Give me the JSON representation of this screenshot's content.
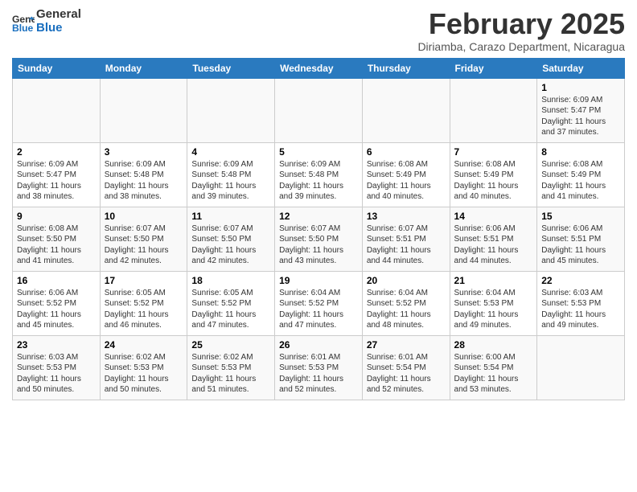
{
  "header": {
    "logo_line1": "General",
    "logo_line2": "Blue",
    "month_year": "February 2025",
    "location": "Diriamba, Carazo Department, Nicaragua"
  },
  "days_of_week": [
    "Sunday",
    "Monday",
    "Tuesday",
    "Wednesday",
    "Thursday",
    "Friday",
    "Saturday"
  ],
  "weeks": [
    [
      {
        "day": "",
        "info": ""
      },
      {
        "day": "",
        "info": ""
      },
      {
        "day": "",
        "info": ""
      },
      {
        "day": "",
        "info": ""
      },
      {
        "day": "",
        "info": ""
      },
      {
        "day": "",
        "info": ""
      },
      {
        "day": "1",
        "info": "Sunrise: 6:09 AM\nSunset: 5:47 PM\nDaylight: 11 hours and 37 minutes."
      }
    ],
    [
      {
        "day": "2",
        "info": "Sunrise: 6:09 AM\nSunset: 5:47 PM\nDaylight: 11 hours and 38 minutes."
      },
      {
        "day": "3",
        "info": "Sunrise: 6:09 AM\nSunset: 5:48 PM\nDaylight: 11 hours and 38 minutes."
      },
      {
        "day": "4",
        "info": "Sunrise: 6:09 AM\nSunset: 5:48 PM\nDaylight: 11 hours and 39 minutes."
      },
      {
        "day": "5",
        "info": "Sunrise: 6:09 AM\nSunset: 5:48 PM\nDaylight: 11 hours and 39 minutes."
      },
      {
        "day": "6",
        "info": "Sunrise: 6:08 AM\nSunset: 5:49 PM\nDaylight: 11 hours and 40 minutes."
      },
      {
        "day": "7",
        "info": "Sunrise: 6:08 AM\nSunset: 5:49 PM\nDaylight: 11 hours and 40 minutes."
      },
      {
        "day": "8",
        "info": "Sunrise: 6:08 AM\nSunset: 5:49 PM\nDaylight: 11 hours and 41 minutes."
      }
    ],
    [
      {
        "day": "9",
        "info": "Sunrise: 6:08 AM\nSunset: 5:50 PM\nDaylight: 11 hours and 41 minutes."
      },
      {
        "day": "10",
        "info": "Sunrise: 6:07 AM\nSunset: 5:50 PM\nDaylight: 11 hours and 42 minutes."
      },
      {
        "day": "11",
        "info": "Sunrise: 6:07 AM\nSunset: 5:50 PM\nDaylight: 11 hours and 42 minutes."
      },
      {
        "day": "12",
        "info": "Sunrise: 6:07 AM\nSunset: 5:50 PM\nDaylight: 11 hours and 43 minutes."
      },
      {
        "day": "13",
        "info": "Sunrise: 6:07 AM\nSunset: 5:51 PM\nDaylight: 11 hours and 44 minutes."
      },
      {
        "day": "14",
        "info": "Sunrise: 6:06 AM\nSunset: 5:51 PM\nDaylight: 11 hours and 44 minutes."
      },
      {
        "day": "15",
        "info": "Sunrise: 6:06 AM\nSunset: 5:51 PM\nDaylight: 11 hours and 45 minutes."
      }
    ],
    [
      {
        "day": "16",
        "info": "Sunrise: 6:06 AM\nSunset: 5:52 PM\nDaylight: 11 hours and 45 minutes."
      },
      {
        "day": "17",
        "info": "Sunrise: 6:05 AM\nSunset: 5:52 PM\nDaylight: 11 hours and 46 minutes."
      },
      {
        "day": "18",
        "info": "Sunrise: 6:05 AM\nSunset: 5:52 PM\nDaylight: 11 hours and 47 minutes."
      },
      {
        "day": "19",
        "info": "Sunrise: 6:04 AM\nSunset: 5:52 PM\nDaylight: 11 hours and 47 minutes."
      },
      {
        "day": "20",
        "info": "Sunrise: 6:04 AM\nSunset: 5:52 PM\nDaylight: 11 hours and 48 minutes."
      },
      {
        "day": "21",
        "info": "Sunrise: 6:04 AM\nSunset: 5:53 PM\nDaylight: 11 hours and 49 minutes."
      },
      {
        "day": "22",
        "info": "Sunrise: 6:03 AM\nSunset: 5:53 PM\nDaylight: 11 hours and 49 minutes."
      }
    ],
    [
      {
        "day": "23",
        "info": "Sunrise: 6:03 AM\nSunset: 5:53 PM\nDaylight: 11 hours and 50 minutes."
      },
      {
        "day": "24",
        "info": "Sunrise: 6:02 AM\nSunset: 5:53 PM\nDaylight: 11 hours and 50 minutes."
      },
      {
        "day": "25",
        "info": "Sunrise: 6:02 AM\nSunset: 5:53 PM\nDaylight: 11 hours and 51 minutes."
      },
      {
        "day": "26",
        "info": "Sunrise: 6:01 AM\nSunset: 5:53 PM\nDaylight: 11 hours and 52 minutes."
      },
      {
        "day": "27",
        "info": "Sunrise: 6:01 AM\nSunset: 5:54 PM\nDaylight: 11 hours and 52 minutes."
      },
      {
        "day": "28",
        "info": "Sunrise: 6:00 AM\nSunset: 5:54 PM\nDaylight: 11 hours and 53 minutes."
      },
      {
        "day": "",
        "info": ""
      }
    ]
  ]
}
